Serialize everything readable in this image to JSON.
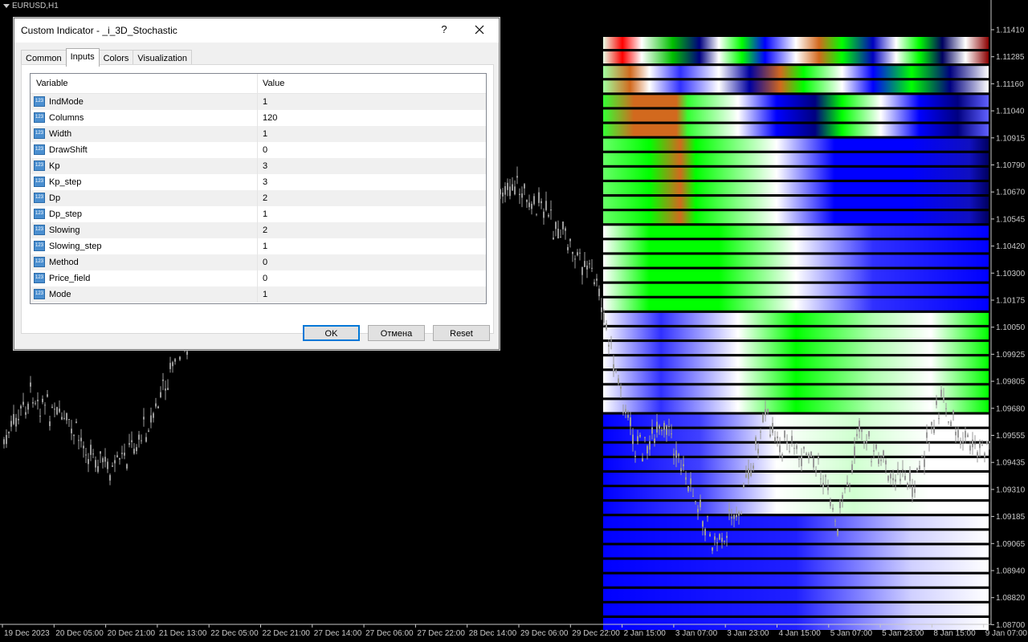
{
  "chart": {
    "symbol_title": "EURUSD,H1",
    "price_labels": [
      "1.11410",
      "1.11285",
      "1.11160",
      "1.11040",
      "1.10915",
      "1.10790",
      "1.10670",
      "1.10545",
      "1.10420",
      "1.10300",
      "1.10175",
      "1.10050",
      "1.09925",
      "1.09805",
      "1.09680",
      "1.09555",
      "1.09435",
      "1.09310",
      "1.09185",
      "1.09065",
      "1.08940",
      "1.08820",
      "1.08700"
    ],
    "time_labels": [
      "19 Dec 2023",
      "20 Dec 05:00",
      "20 Dec 21:00",
      "21 Dec 13:00",
      "22 Dec 05:00",
      "22 Dec 21:00",
      "27 Dec 14:00",
      "27 Dec 06:00",
      "27 Dec 22:00",
      "28 Dec 14:00",
      "29 Dec 06:00",
      "29 Dec 22:00",
      "2 Jan 15:00",
      "3 Jan 07:00",
      "3 Jan 23:00",
      "4 Jan 15:00",
      "5 Jan 07:00",
      "5 Jan 23:00",
      "8 Jan 15:00",
      "9 Jan 07:00"
    ],
    "colors": {
      "background": "#000000",
      "axis_text": "#c8c8c8",
      "candle": "#9a9a9a",
      "green": "#00ff00",
      "blue": "#0000ff",
      "orange": "#d2691e",
      "darkred": "#8b0000",
      "navy": "#000080",
      "white": "#ffffff"
    }
  },
  "dialog": {
    "title": "Custom Indicator - _i_3D_Stochastic",
    "help_label": "?",
    "close_icon": "close-icon",
    "tabs": [
      {
        "label": "Common",
        "active": false
      },
      {
        "label": "Inputs",
        "active": true
      },
      {
        "label": "Colors",
        "active": false
      },
      {
        "label": "Visualization",
        "active": false
      }
    ],
    "table": {
      "col_variable": "Variable",
      "col_value": "Value",
      "icon_text": "123",
      "rows": [
        {
          "name": "IndMode",
          "value": "1"
        },
        {
          "name": "Columns",
          "value": "120"
        },
        {
          "name": "Width",
          "value": "1"
        },
        {
          "name": "DrawShift",
          "value": "0"
        },
        {
          "name": "Kp",
          "value": "3"
        },
        {
          "name": "Kp_step",
          "value": "3"
        },
        {
          "name": "Dp",
          "value": "2"
        },
        {
          "name": "Dp_step",
          "value": "1"
        },
        {
          "name": "Slowing",
          "value": "2"
        },
        {
          "name": "Slowing_step",
          "value": "1"
        },
        {
          "name": "Method",
          "value": "0"
        },
        {
          "name": "Price_field",
          "value": "0"
        },
        {
          "name": "Mode",
          "value": "1"
        }
      ]
    },
    "buttons": {
      "ok": "OK",
      "cancel": "Отмена",
      "reset": "Reset"
    }
  }
}
